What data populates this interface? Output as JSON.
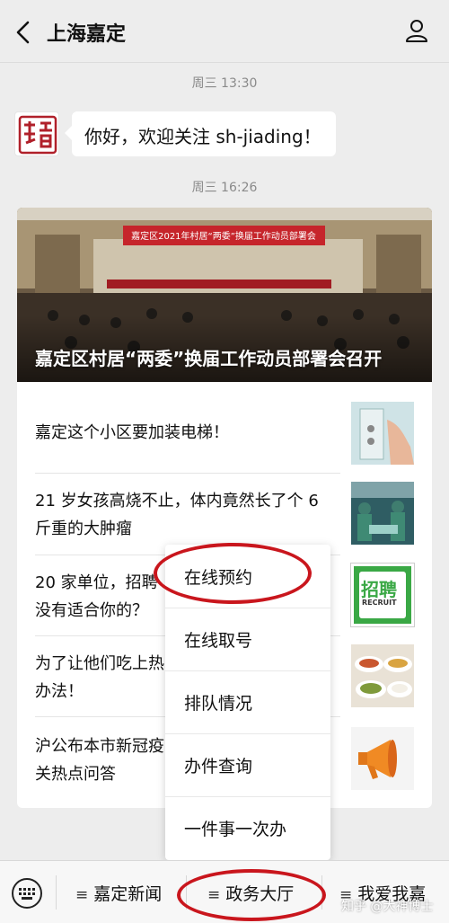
{
  "header": {
    "title": "上海嘉定",
    "back_icon": "chevron-left-icon",
    "profile_icon": "user-icon"
  },
  "chat": {
    "time1": "周三 13:30",
    "welcome": "你好，欢迎关注 sh-jiading！",
    "time2": "周三 16:26",
    "hero": {
      "banner": "嘉定区2021年村居“两委”换届工作动员部署会",
      "title": "嘉定区村居“两委”换届工作动员部署会召开"
    },
    "articles": [
      {
        "title": "嘉定这个小区要加装电梯！"
      },
      {
        "title": "21 岁女孩高烧不止，体内竟然长了个 6 斤重的大肿瘤"
      },
      {
        "title": "20 家单位，招聘",
        "tail": "没有适合你的？"
      },
      {
        "title": "为了让他们吃上热",
        "tail": "办法！"
      },
      {
        "title": "沪公布本市新冠疫",
        "tail": "关热点问答"
      }
    ]
  },
  "popup_menu": {
    "items": [
      "在线预约",
      "在线取号",
      "排队情况",
      "办件查询",
      "一件事一次办"
    ]
  },
  "bottom_menu": {
    "keyboard_icon": "keyboard-icon",
    "items": [
      "嘉定新闻",
      "政务大厅",
      "我爱我嘉"
    ]
  },
  "thumb_recruit": {
    "big": "招聘",
    "small": "RECRUIT"
  },
  "watermark": "知乎 @大神博士",
  "colors": {
    "highlight_circle": "#c9161d",
    "recruit_green": "#3aa845"
  }
}
